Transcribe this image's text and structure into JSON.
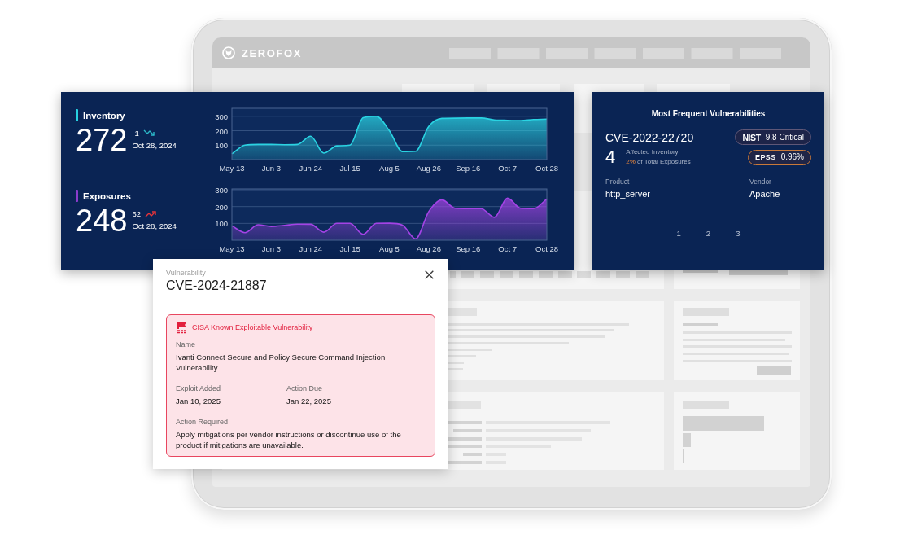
{
  "device": {
    "brand": "ZEROFOX"
  },
  "trends_panel": {
    "metrics": [
      {
        "label": "Inventory",
        "color": "#27d0e0",
        "value": "272",
        "change": "-1",
        "rising": false,
        "date": "Oct 28, 2024",
        "chart_data": {
          "type": "area",
          "categories": [
            "May 13",
            null,
            null,
            "Jun 3",
            null,
            null,
            "Jun 24",
            null,
            null,
            "Jul 15",
            null,
            null,
            "Aug 5",
            null,
            null,
            "Aug 26",
            null,
            null,
            "Sep 16",
            null,
            null,
            "Oct 7",
            null,
            null,
            "Oct 28"
          ],
          "ylim": [
            0,
            355
          ],
          "yticks": [
            100,
            200,
            300
          ],
          "grid": true,
          "series": [
            {
              "color": "#2ad3e2",
              "values": [
                40,
                100,
                105,
                105,
                103,
                105,
                162,
                45,
                95,
                100,
                290,
                300,
                200,
                55,
                58,
                230,
                285,
                287,
                288,
                288,
                275,
                272,
                270,
                277,
                280
              ]
            }
          ]
        }
      },
      {
        "label": "Exposures",
        "color": "#8b3ccc",
        "value": "248",
        "change": "62",
        "rising": true,
        "date": "Oct 28, 2024",
        "chart_data": {
          "type": "area",
          "categories": [
            "May 13",
            null,
            null,
            "Jun 3",
            null,
            null,
            "Jun 24",
            null,
            null,
            "Jul 15",
            null,
            null,
            "Aug 5",
            null,
            null,
            "Aug 26",
            null,
            null,
            "Sep 16",
            null,
            null,
            "Oct 7",
            null,
            null,
            "Oct 28"
          ],
          "ylim": [
            0,
            305
          ],
          "yticks": [
            100,
            200,
            300
          ],
          "grid": true,
          "series": [
            {
              "color": "#a443e6",
              "values": [
                85,
                45,
                92,
                82,
                88,
                96,
                95,
                48,
                100,
                100,
                35,
                100,
                101,
                90,
                8,
                170,
                240,
                190,
                188,
                188,
                136,
                250,
                190,
                188,
                245
              ]
            }
          ]
        }
      }
    ]
  },
  "vulnerabilities_panel": {
    "title": "Most Frequent Vulnerabilities",
    "cve": "CVE-2022-22720",
    "count": "4",
    "count_label": "Affected Inventory",
    "share_value": "2%",
    "share_text": "of Total Exposures",
    "badges": [
      {
        "kind": "nist",
        "logo": "NIST",
        "value": "9.8 Critical"
      },
      {
        "kind": "epss",
        "logo": "EPSS",
        "value": "0.96%"
      }
    ],
    "fields": [
      {
        "label": "Product",
        "value": "http_server"
      },
      {
        "label": "Vendor",
        "value": "Apache"
      }
    ],
    "pages": [
      "1",
      "2",
      "3"
    ]
  },
  "vulnerability_popup": {
    "caption": "Vulnerability",
    "title": "CVE-2024-21887",
    "alert": {
      "heading": "CISA Known Exploitable Vulnerability",
      "rows": [
        [
          {
            "label": "Name",
            "value": "Ivanti Connect Secure and Policy Secure Command Injection Vulnerability"
          }
        ],
        [
          {
            "label": "Exploit Added",
            "value": "Jan 10, 2025"
          },
          {
            "label": "Action Due",
            "value": "Jan 22, 2025"
          }
        ],
        [
          {
            "label": "Action Required",
            "value": "Apply mitigations per vendor instructions or discontinue use of the product if mitigations are unavailable."
          }
        ]
      ]
    }
  }
}
